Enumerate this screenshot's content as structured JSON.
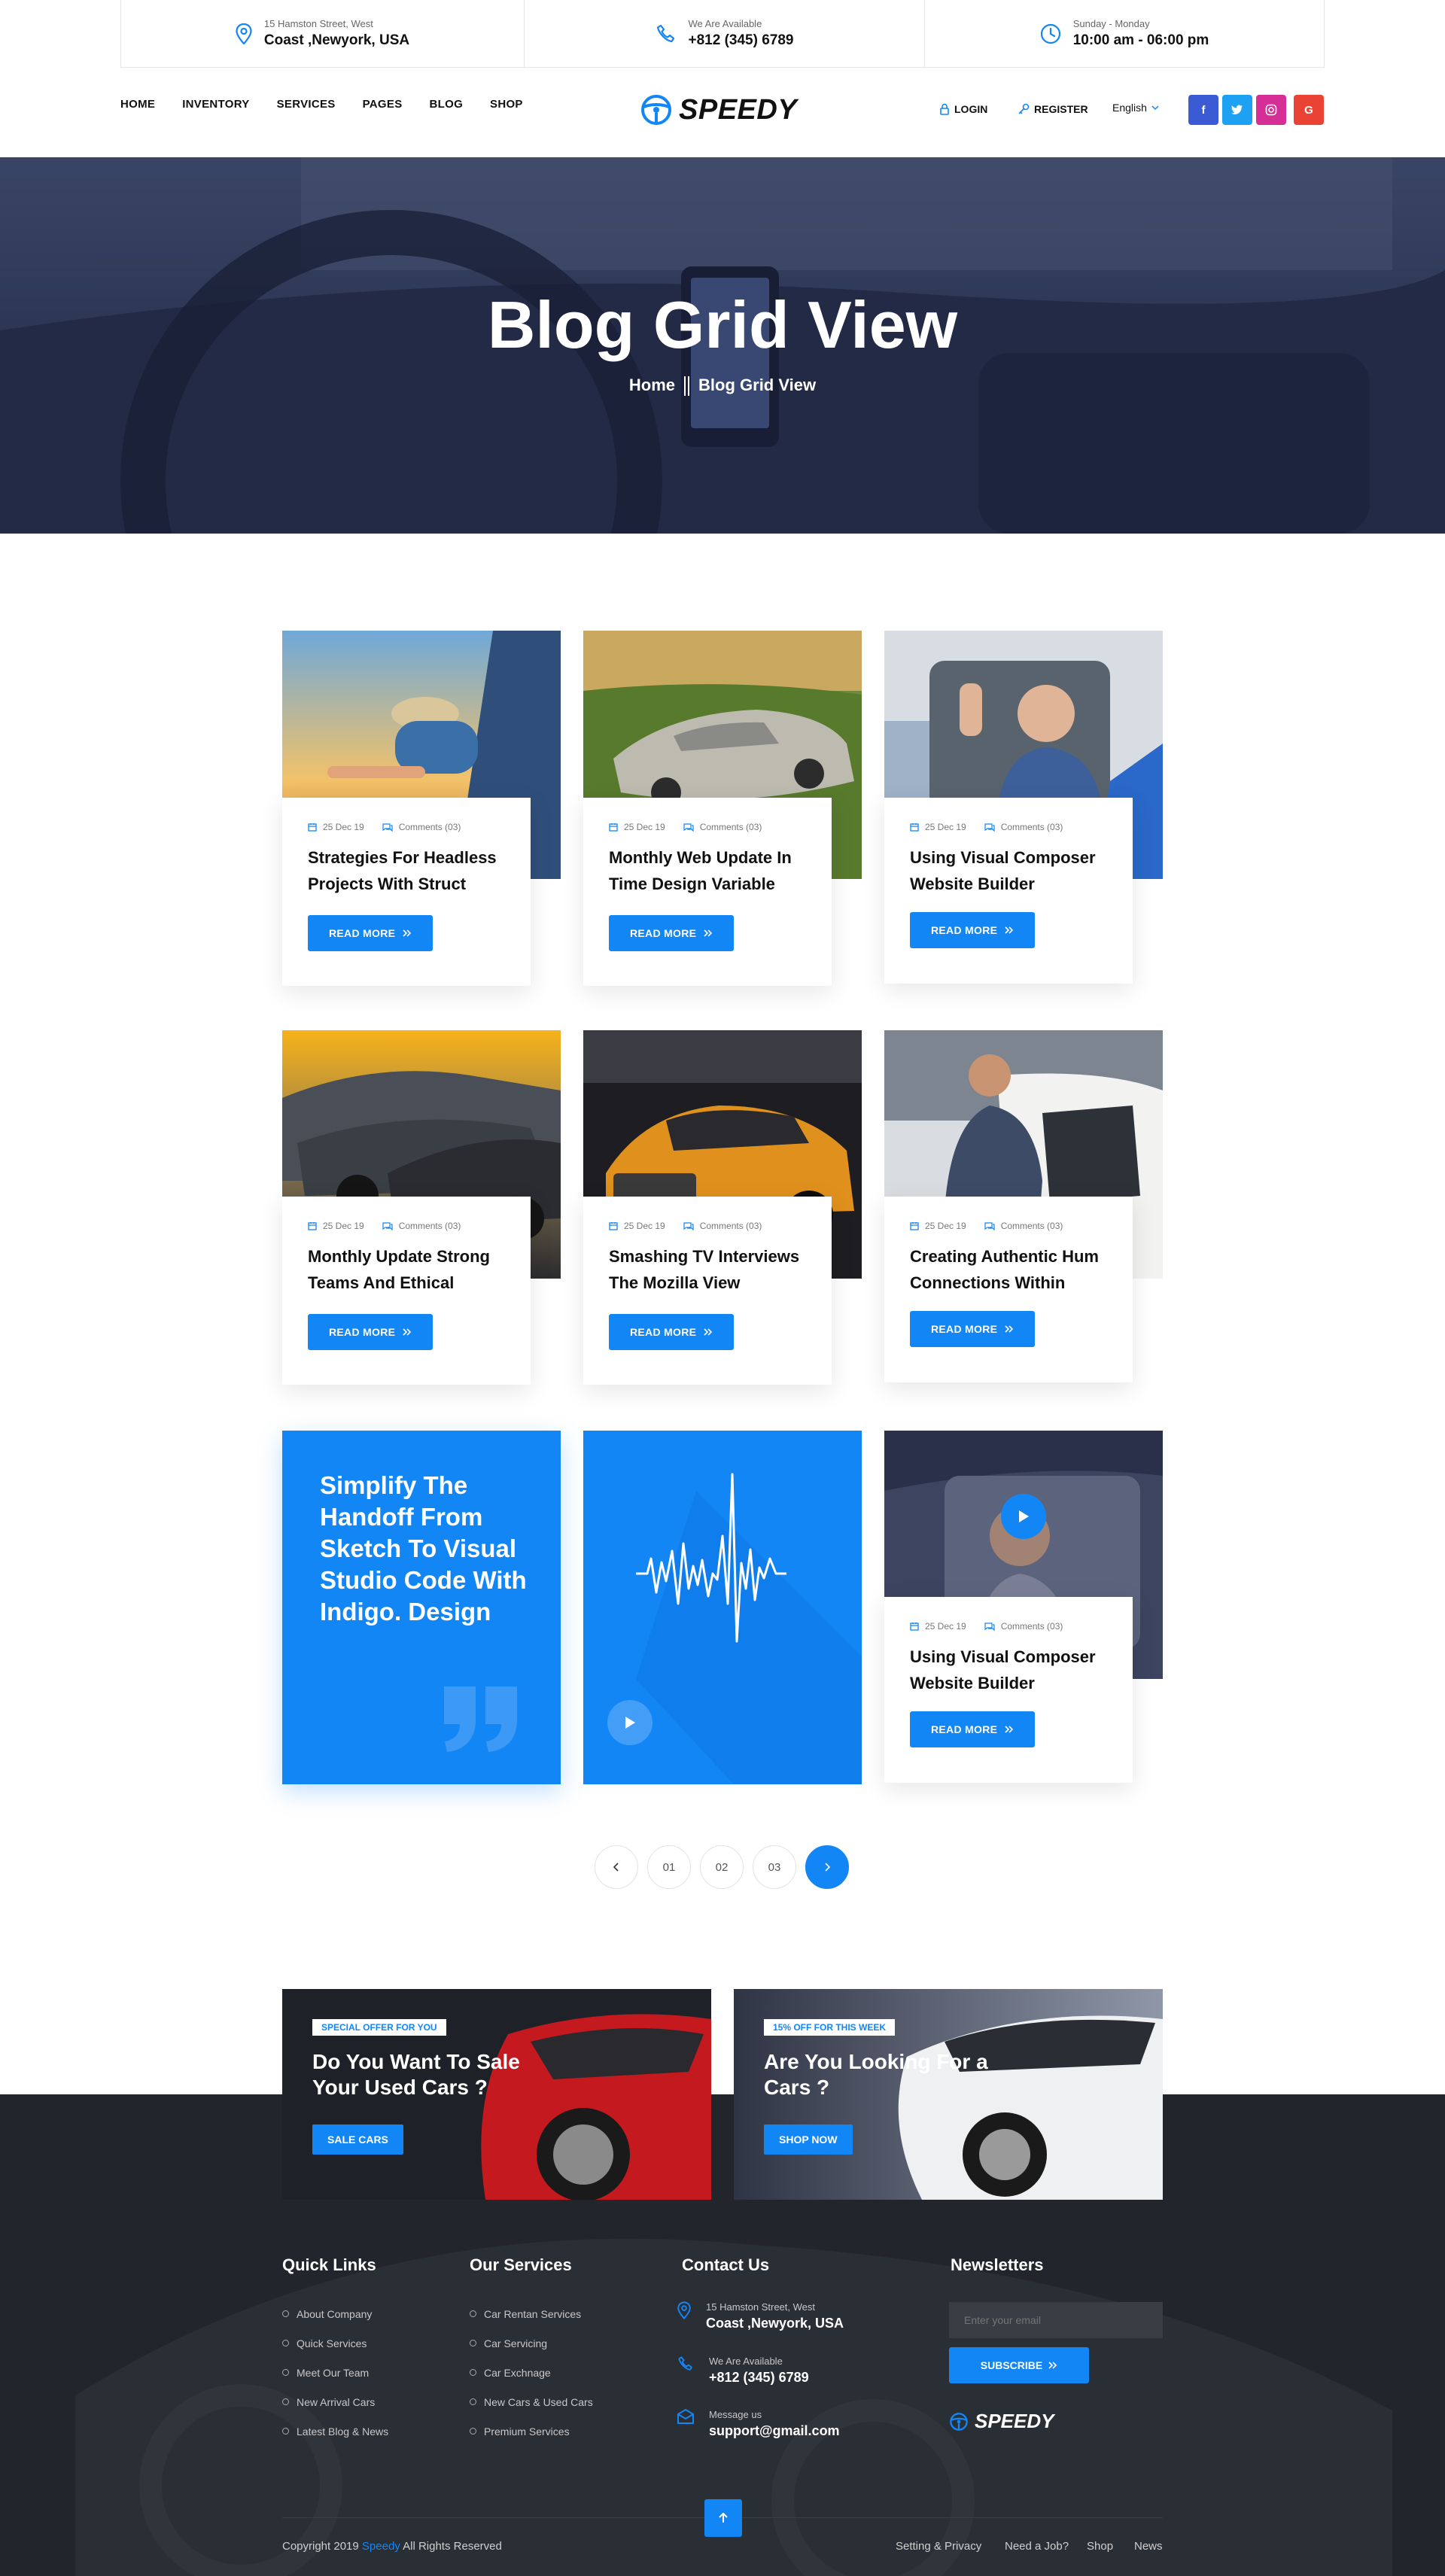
{
  "topbar": {
    "address_small": "15 Hamston Street, West",
    "address_big": "Coast ,Newyork, USA",
    "phone_small": "We Are Available",
    "phone_big": "+812 (345) 6789",
    "hours_small": "Sunday - Monday",
    "hours_big": "10:00 am - 06:00 pm"
  },
  "nav": {
    "items": [
      "HOME",
      "INVENTORY",
      "SERVICES",
      "PAGES",
      "BLOG",
      "SHOP"
    ],
    "logo": "SPEEDY",
    "login": "LOGIN",
    "register": "REGISTER",
    "language": "English",
    "social": [
      "f",
      "t",
      "i",
      "G"
    ]
  },
  "colors": {
    "accent": "#1386f6",
    "facebook": "#3b5bd5",
    "twitter": "#1da1f2",
    "instagram": "#d62e97",
    "google": "#ea4335",
    "footer_bg": "#22252b"
  },
  "hero": {
    "title": "Blog Grid View",
    "crumb_home": "Home",
    "crumb_current": "Blog Grid View"
  },
  "posts": [
    {
      "date": "25 Dec 19",
      "comments": "Comments (03)",
      "title": "Strategies For Headless Projects With Struct",
      "button": "READ MORE"
    },
    {
      "date": "25 Dec 19",
      "comments": "Comments (03)",
      "title": "Monthly Web Update In Time Design Variable",
      "button": "READ MORE"
    },
    {
      "date": "25 Dec 19",
      "comments": "Comments (03)",
      "title": "Using Visual Composer Website Builder",
      "button": "READ MORE"
    },
    {
      "date": "25 Dec 19",
      "comments": "Comments (03)",
      "title": "Monthly Update Strong Teams And Ethical",
      "button": "READ MORE"
    },
    {
      "date": "25 Dec 19",
      "comments": "Comments (03)",
      "title": "Smashing TV Interviews The Mozilla View",
      "button": "READ MORE"
    },
    {
      "date": "25 Dec 19",
      "comments": "Comments (03)",
      "title": "Creating Authentic Hum Connections Within",
      "button": "READ MORE"
    },
    {
      "date": "25 Dec 19",
      "comments": "Comments (03)",
      "title": "Using Visual Composer Website Builder",
      "button": "READ MORE"
    }
  ],
  "quote_card": {
    "text": "Simplify The Handoff From Sketch To Visual Studio Code With Indigo. Design"
  },
  "pagination": [
    "01",
    "02",
    "03"
  ],
  "promos": [
    {
      "tag": "SPECIAL OFFER FOR YOU",
      "title": "Do You Want To Sale Your Used Cars ?",
      "button": "SALE CARS"
    },
    {
      "tag": "15% OFF FOR THIS WEEK",
      "title": "Are You Looking For a Cars ?",
      "button": "SHOP NOW"
    }
  ],
  "footer": {
    "quick_links_title": "Quick Links",
    "quick_links": [
      "About Company",
      "Quick Services",
      "Meet Our Team",
      "New Arrival Cars",
      "Latest Blog & News"
    ],
    "services_title": "Our Services",
    "services": [
      "Car Rentan Services",
      "Car Servicing",
      "Car Exchnage",
      "New Cars & Used Cars",
      "Premium Services"
    ],
    "contact_title": "Contact Us",
    "contact": [
      {
        "small": "15 Hamston Street, West",
        "big": "Coast ,Newyork, USA"
      },
      {
        "small": "We Are Available",
        "big": "+812 (345) 6789"
      },
      {
        "small": "Message us",
        "big": "support@gmail.com"
      }
    ],
    "newsletter_title": "Newsletters",
    "email_placeholder": "Enter your email",
    "subscribe": "SUBSCRIBE",
    "logo": "SPEEDY",
    "copyright_pre": "Copyright 2019",
    "copyright_brand": "Speedy",
    "copyright_post": "All Rights Reserved",
    "bottom_links": [
      "Setting & Privacy",
      "Need a Job?",
      "Shop",
      "News"
    ]
  }
}
